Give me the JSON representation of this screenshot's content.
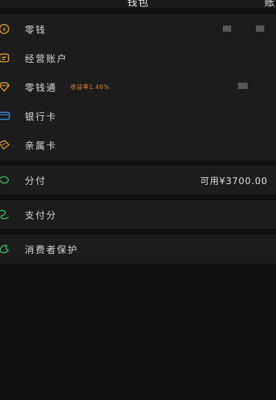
{
  "header": {
    "title": "钱包",
    "right_partial": "账"
  },
  "wallet_items": [
    {
      "label": "零钱"
    },
    {
      "label": "经营账户"
    },
    {
      "label": "零钱通",
      "badge": "收益率1.46%"
    },
    {
      "label": "银行卡"
    },
    {
      "label": "亲属卡"
    }
  ],
  "fenfu": {
    "label": "分付",
    "value": "可用¥3700.00"
  },
  "zhifufen": {
    "label": "支付分"
  },
  "consumer": {
    "label": "消费者保护"
  },
  "colors": {
    "gold": "#e0a33a",
    "blue": "#3a8fdc",
    "green": "#3fbf6a",
    "orange": "#e08a2e"
  }
}
